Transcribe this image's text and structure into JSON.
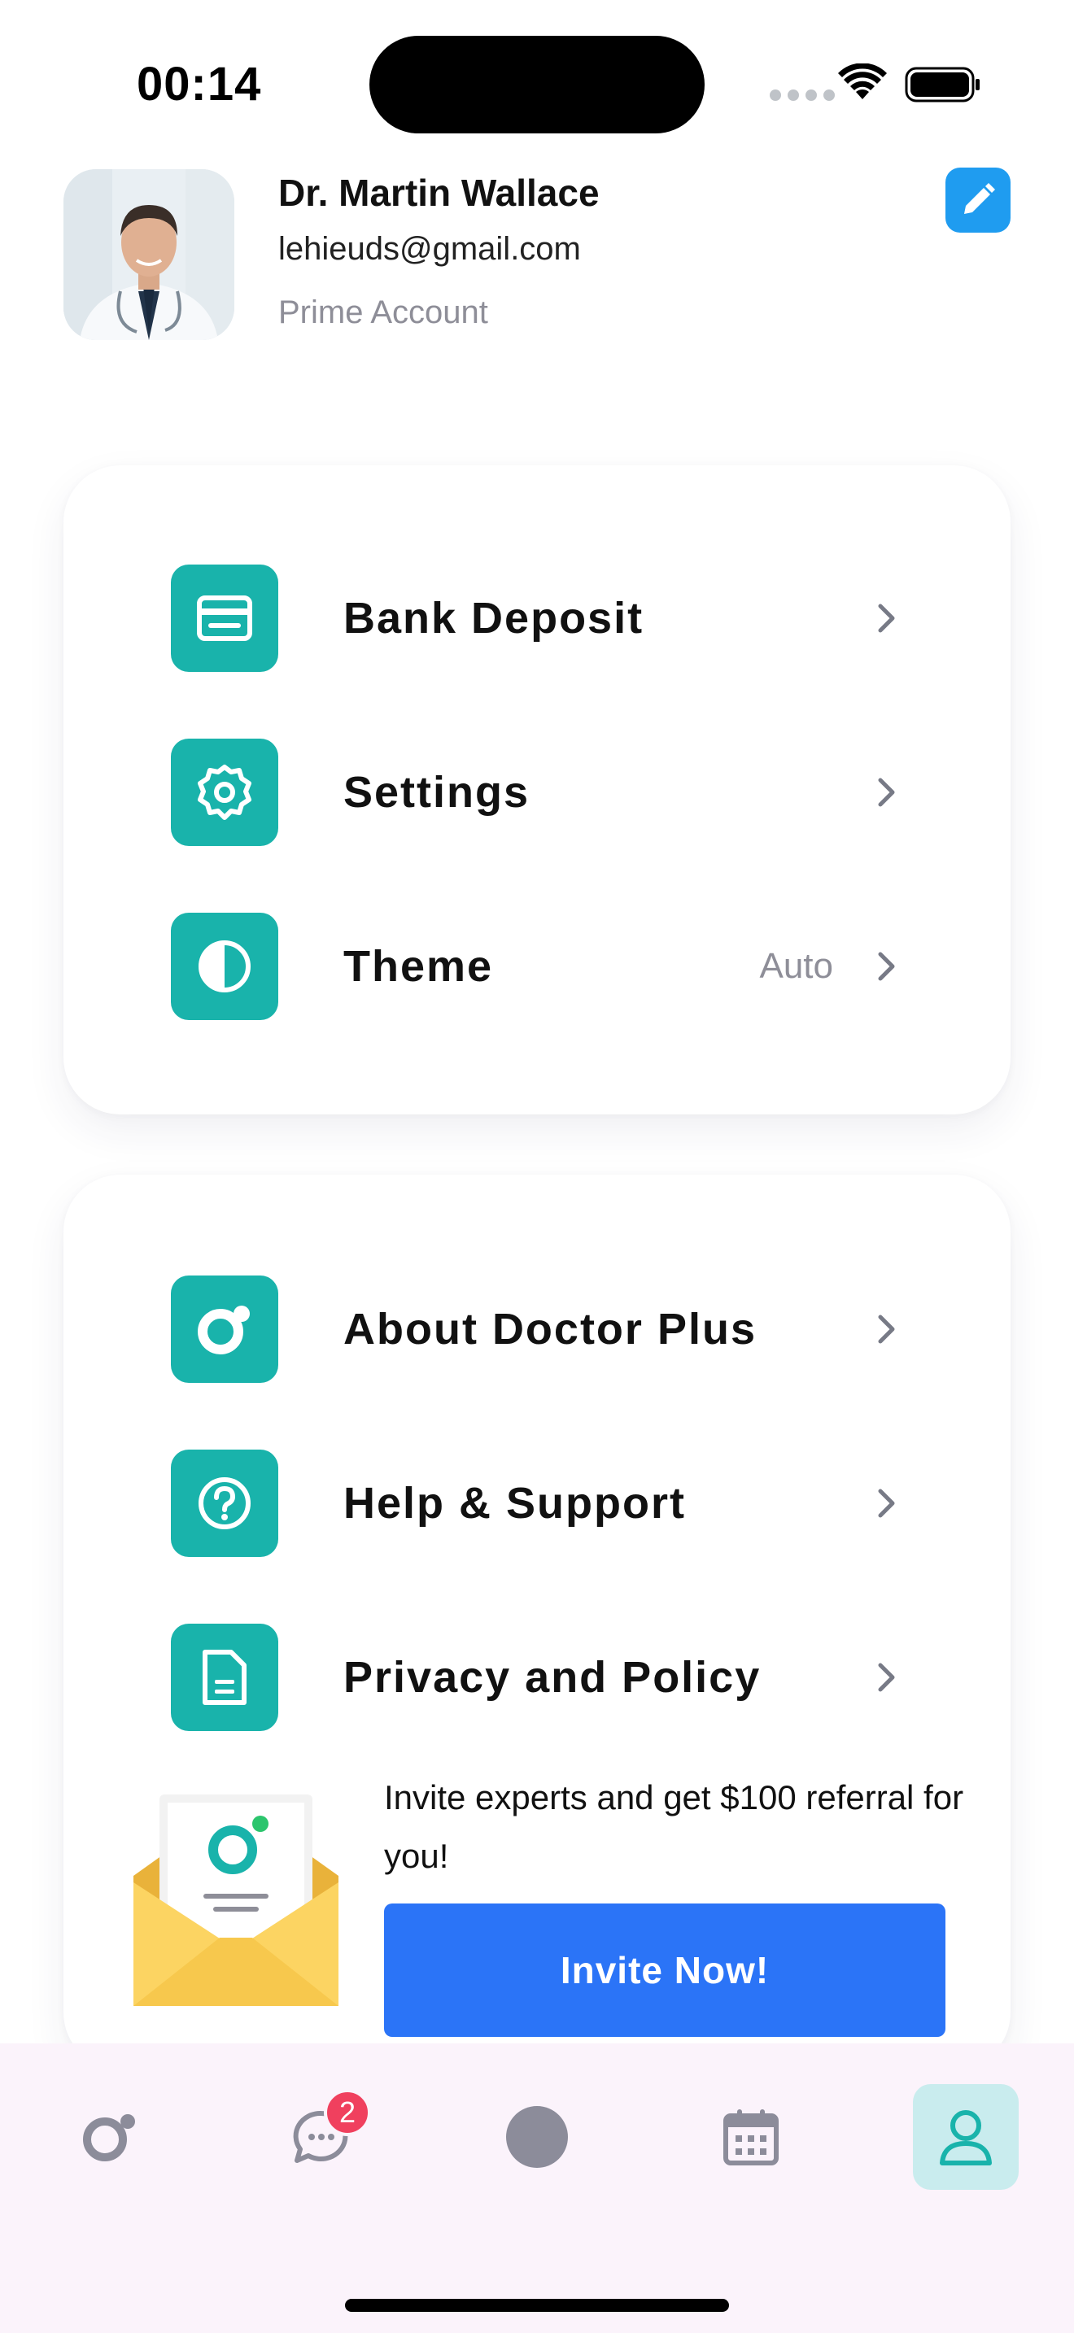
{
  "status_bar": {
    "time": "00:14"
  },
  "profile": {
    "name": "Dr. Martin Wallace",
    "email": "lehieuds@gmail.com",
    "plan": "Prime Account"
  },
  "menu_group_1": [
    {
      "label": "Bank Deposit",
      "icon": "bank-card-icon",
      "value": ""
    },
    {
      "label": "Settings",
      "icon": "gear-icon",
      "value": ""
    },
    {
      "label": "Theme",
      "icon": "contrast-icon",
      "value": "Auto"
    }
  ],
  "menu_group_2": [
    {
      "label": "About Doctor Plus",
      "icon": "doctor-plus-logo-icon"
    },
    {
      "label": "Help & Support",
      "icon": "question-circle-icon"
    },
    {
      "label": "Privacy and Policy",
      "icon": "document-icon"
    }
  ],
  "invite": {
    "text": "Invite experts and get $100 referral for you!",
    "button_label": "Invite Now!"
  },
  "tabbar": {
    "messages_badge": "2",
    "tabs": [
      "home",
      "messages",
      "center",
      "calendar",
      "profile"
    ],
    "active": "profile"
  },
  "colors": {
    "teal": "#19b3ab",
    "blue": "#2b74f7",
    "edit_blue": "#1f9cf0",
    "badge_red": "#f0405e",
    "tab_bg": "#fbf3fb"
  }
}
